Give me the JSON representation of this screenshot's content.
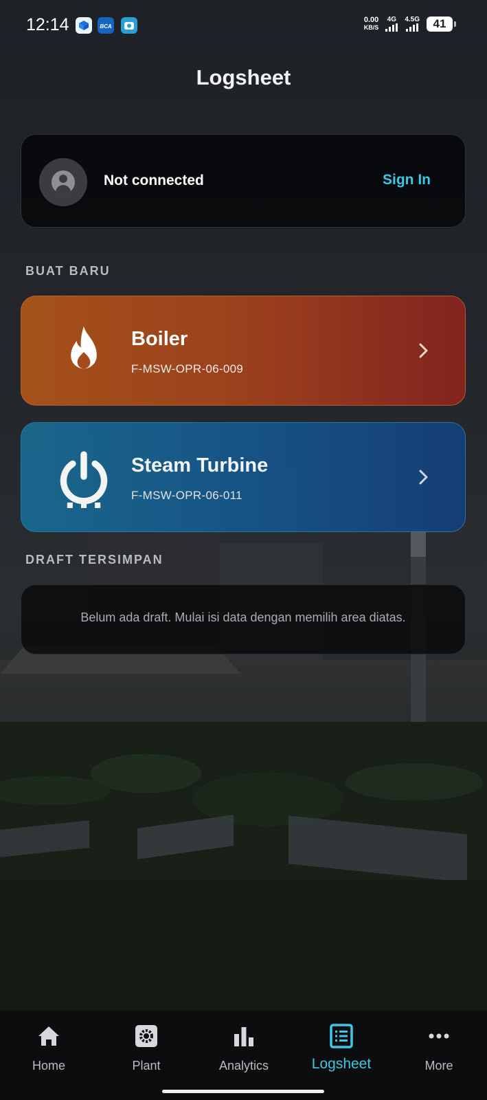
{
  "status_bar": {
    "time": "12:14",
    "net_speed_value": "0.00",
    "net_speed_unit": "KB/S",
    "signal1_label": "4G",
    "signal2_label": "4.5G",
    "battery": "41",
    "notification_icons": [
      "box-app-icon",
      "mybca-app-icon",
      "camera-app-icon"
    ]
  },
  "header": {
    "title": "Logsheet"
  },
  "account": {
    "status": "Not connected",
    "sign_in_label": "Sign In"
  },
  "sections": {
    "new_label": "BUAT BARU",
    "draft_label": "DRAFT TERSIMPAN"
  },
  "areas": [
    {
      "title": "Boiler",
      "code": "F-MSW-OPR-06-009",
      "icon": "flame-icon"
    },
    {
      "title": "Steam Turbine",
      "code": "F-MSW-OPR-06-011",
      "icon": "power-icon"
    }
  ],
  "drafts": {
    "empty_message": "Belum ada draft. Mulai isi data dengan memilih area diatas."
  },
  "nav": {
    "items": [
      {
        "label": "Home",
        "icon": "home-icon"
      },
      {
        "label": "Plant",
        "icon": "gear-icon"
      },
      {
        "label": "Analytics",
        "icon": "bar-chart-icon"
      },
      {
        "label": "Logsheet",
        "icon": "list-icon",
        "active": true
      },
      {
        "label": "More",
        "icon": "more-icon"
      }
    ]
  },
  "colors": {
    "accent": "#3ec7e6",
    "boiler": "#9a3e1d",
    "turbine": "#16548a"
  }
}
